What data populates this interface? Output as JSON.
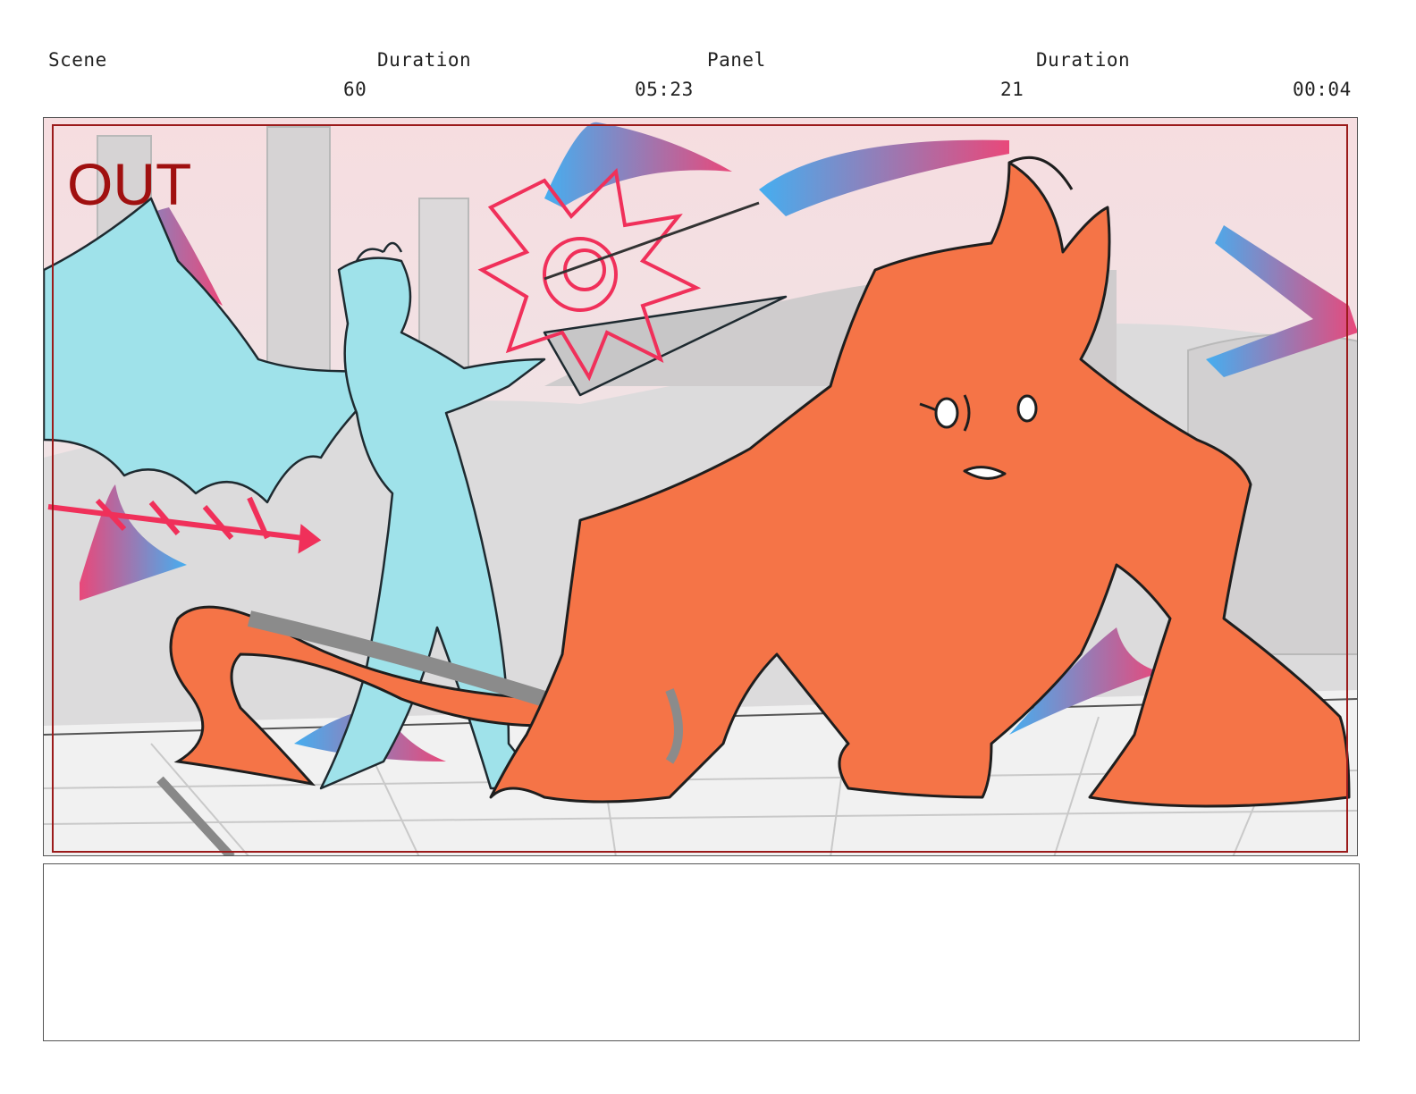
{
  "header": {
    "scene_label": "Scene",
    "scene_duration_label": "Duration",
    "panel_label": "Panel",
    "panel_duration_label": "Duration",
    "scene_number": "60",
    "scene_duration": "05:23",
    "panel_number": "21",
    "panel_duration": "00:04"
  },
  "artwork": {
    "camera_note": "OUT",
    "camera_note_color": "#a01010",
    "safe_frame_color": "#9b1b1b",
    "orange_character_color": "#f57447",
    "blue_character_color": "#9fe2ea",
    "magic_burst_color": "#f0305a",
    "ribbon_color_a": "#45aef0",
    "ribbon_color_b": "#e9487a"
  },
  "notes": {
    "text": ""
  }
}
